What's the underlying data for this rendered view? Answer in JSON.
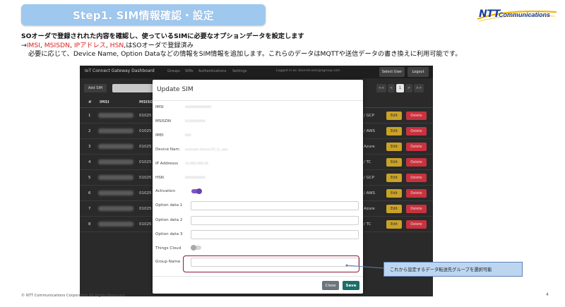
{
  "banner": {
    "title": "Step1. SIM情報確認・設定"
  },
  "logo": {
    "ntt": "NTT",
    "comm": "Communications"
  },
  "description": {
    "line1": "SOオーダで登録されれた内容を確認し、使っているSIMに必要なオプションデータを設定します",
    "line2": {
      "arrow": "→",
      "imsi": "IMSI",
      "sep1": ", ",
      "msisdn": "MSISDN",
      "sep2": ", ",
      "ip": "IPアドレス",
      "sep3": ", ",
      "hsn": "HSN",
      "suffix": ",はSOオーダで登録済み"
    },
    "line3": "必要に応じて、Device Name, Option Dataなどの情報をSIM情報を追加します。これらのデータはMQTTや送信データの書き換えに利用可能です。"
  },
  "app": {
    "nav": {
      "brand": "IoT Connect Gateway Dashboard",
      "links": [
        "Groups",
        "SIMs",
        "Authentications",
        "Settings"
      ],
      "login": "Logged in as: blurred-user@ngroup.com",
      "select_user": "Select User",
      "logout": "Logout"
    },
    "toolbar": {
      "add_sim": "Add SIM",
      "pager": [
        "<<",
        "<",
        "1",
        ">",
        ">>"
      ]
    },
    "table": {
      "headers": [
        "#",
        "IMSI",
        "MSISDN"
      ],
      "rows": [
        {
          "num": "1",
          "msisdn": "01025",
          "cloud": "/ GCP",
          "edit": "Edit",
          "delete": "Delete"
        },
        {
          "num": "2",
          "msisdn": "01025",
          "cloud": "/ AWS",
          "edit": "Edit",
          "delete": "Delete"
        },
        {
          "num": "3",
          "msisdn": "01025",
          "cloud": "Azure",
          "edit": "Edit",
          "delete": "Delete"
        },
        {
          "num": "4",
          "msisdn": "01025",
          "cloud": "/ TC",
          "edit": "Edit",
          "delete": "Delete"
        },
        {
          "num": "5",
          "msisdn": "01025",
          "cloud": "/ GCP",
          "edit": "Edit",
          "delete": "Delete"
        },
        {
          "num": "6",
          "msisdn": "01025",
          "cloud": "/ AWS",
          "edit": "Edit",
          "delete": "Delete"
        },
        {
          "num": "7",
          "msisdn": "01025",
          "cloud": "Azure",
          "edit": "Edit",
          "delete": "Delete"
        },
        {
          "num": "8",
          "msisdn": "01025",
          "cloud": "/ TC",
          "edit": "Edit",
          "delete": "Delete"
        }
      ]
    }
  },
  "modal": {
    "title": "Update SIM",
    "fields": {
      "imsi": {
        "label": "IMSI",
        "value": "4400000000000"
      },
      "msisdn": {
        "label": "MSISDN",
        "value": "0100000000"
      },
      "imei": {
        "label": "IMEI",
        "value": "000"
      },
      "device_name": {
        "label": "Device Nam",
        "value": "example-device-01_tc_aws"
      },
      "ip_address": {
        "label": "IP Addresss",
        "value": "10.000.000.00"
      },
      "hsn": {
        "label": "HSN",
        "value": "0000000000"
      },
      "activation": {
        "label": "Activation"
      },
      "option1": {
        "label": "Option data 1"
      },
      "option2": {
        "label": "Option data 2"
      },
      "option3": {
        "label": "Option data 3"
      },
      "things_cloud": {
        "label": "Things Cloud"
      },
      "group_name": {
        "label": "Group Name"
      }
    },
    "close": "Close",
    "save": "Save"
  },
  "callout": {
    "text": "これから設定するデータ転送先グループを選択可能"
  },
  "footer": {
    "copyright": "© NTT Communications Corporation All Rights Reserved.",
    "page": "4"
  },
  "colors": {
    "banner": "#9fc8ef",
    "highlight": "#8b1a3c",
    "callout": "#bcd6f2",
    "edit": "#c9a227",
    "delete": "#c8323e",
    "save": "#1b6f68",
    "toggle": "#7d57c1"
  }
}
